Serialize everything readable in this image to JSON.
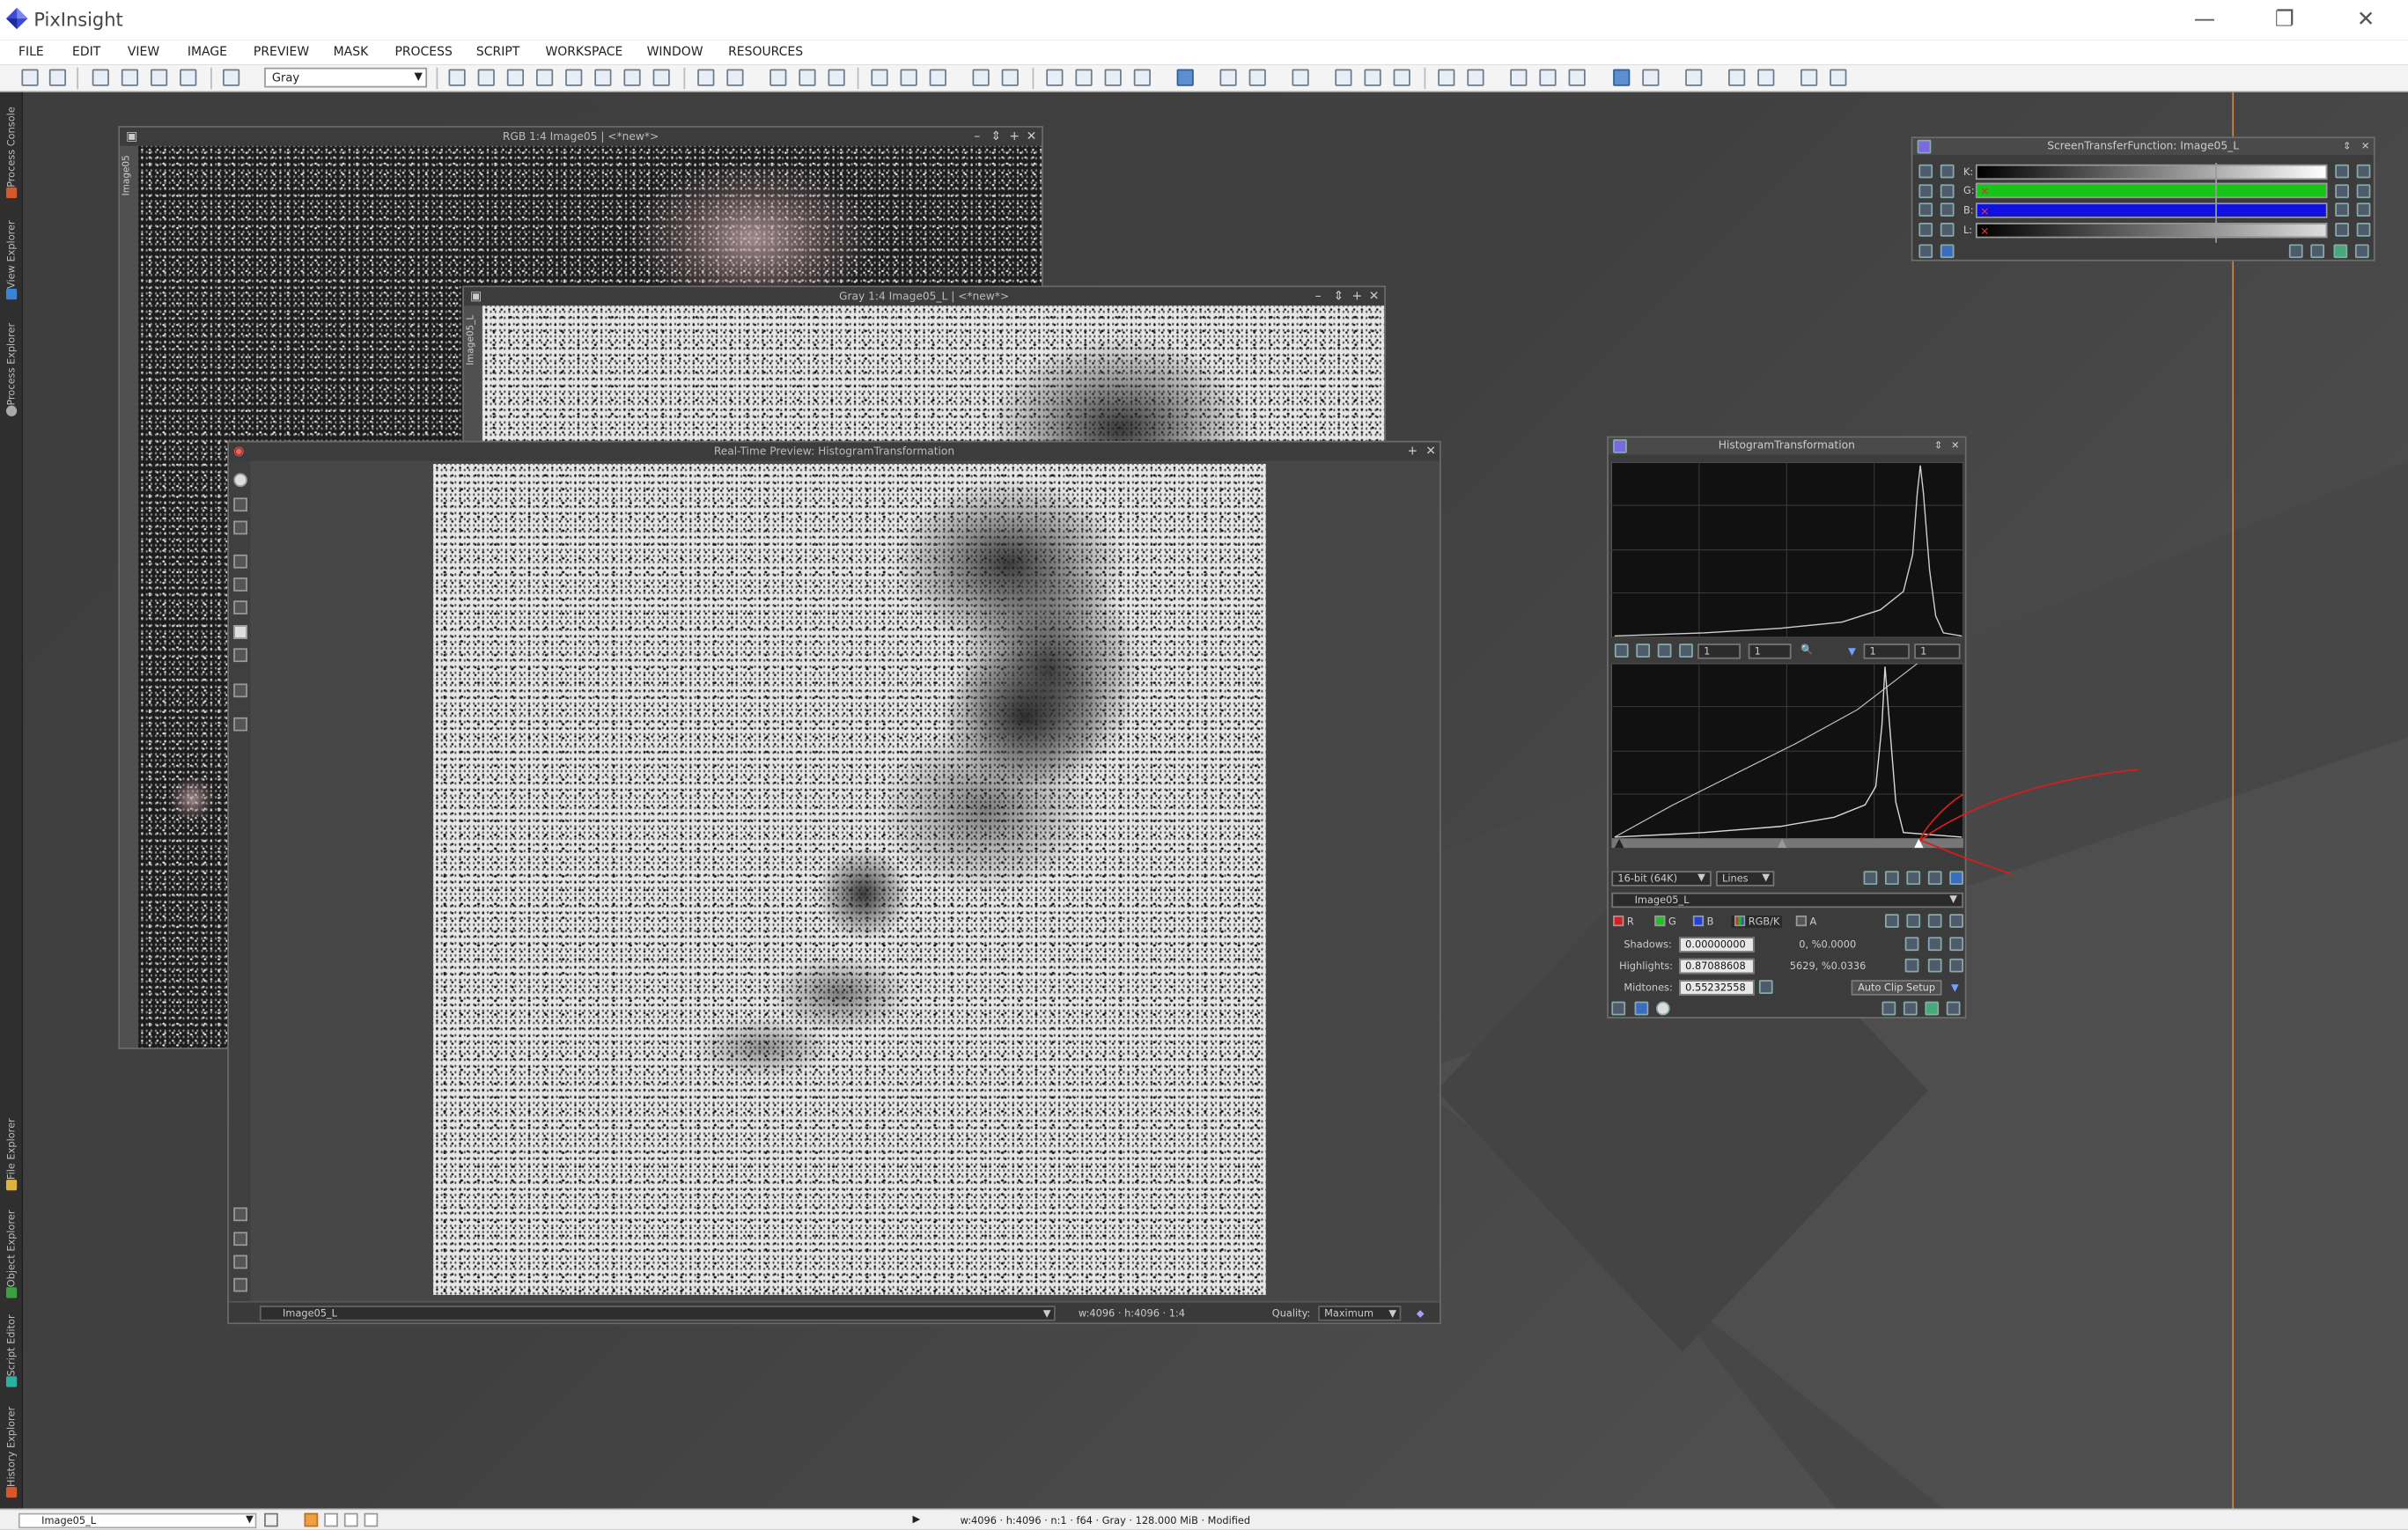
{
  "app": {
    "title": "PixInsight"
  },
  "window_controls": {
    "minimize": "—",
    "restore": "❐",
    "close": "✕"
  },
  "menu": [
    "FILE",
    "EDIT",
    "VIEW",
    "IMAGE",
    "PREVIEW",
    "MASK",
    "PROCESS",
    "SCRIPT",
    "WORKSPACE",
    "WINDOW",
    "RESOURCES"
  ],
  "toolbar": {
    "color_space": "Gray"
  },
  "left_dock": {
    "tabs": [
      "Process Console",
      "View Explorer",
      "Process Explorer",
      "File Explorer",
      "Object Explorer",
      "Script Editor",
      "History Explorer"
    ]
  },
  "windows": {
    "rgb": {
      "title": "RGB 1:4 Image05 | <*new*>",
      "side_label": "Image05"
    },
    "gray": {
      "title": "Gray 1:4 Image05_L | <*new*>",
      "side_label": "Image05_L"
    },
    "preview": {
      "title": "Real-Time Preview: HistogramTransformation",
      "view": "Image05_L",
      "info": "w:4096 · h:4096 · 1:4",
      "quality_label": "Quality:",
      "quality": "Maximum"
    }
  },
  "stf": {
    "title": "ScreenTransferFunction: Image05_L",
    "channels": [
      {
        "label": "K:",
        "color": "#e8e8e8"
      },
      {
        "label": "G:",
        "color": "#19c419"
      },
      {
        "label": "B:",
        "color": "#1010e0"
      },
      {
        "label": "L:",
        "color": "#bdbdbd"
      }
    ]
  },
  "ht": {
    "title": "HistogramTransformation",
    "zoom_fields": [
      "1",
      "1",
      "1",
      "1"
    ],
    "resolution": "16-bit (64K)",
    "graph_style": "Lines",
    "view": "Image05_L",
    "channels": [
      {
        "label": "R",
        "color": "#d62020"
      },
      {
        "label": "G",
        "color": "#22c022"
      },
      {
        "label": "B",
        "color": "#2040e0"
      },
      {
        "label": "RGB/K",
        "color": "#888888"
      },
      {
        "label": "A",
        "color": "#555555"
      }
    ],
    "shadows_label": "Shadows:",
    "shadows": "0.00000000",
    "shadows_clip": "0, %0.0000",
    "highlights_label": "Highlights:",
    "highlights": "0.87088608",
    "highlights_clip": "5629, %0.0336",
    "midtones_label": "Midtones:",
    "midtones": "0.55232558",
    "auto_clip": "Auto Clip Setup"
  },
  "statusbar": {
    "view": "Image05_L",
    "info": "w:4096 · h:4096 · n:1 · f64 · Gray · 128.000 MiB · Modified"
  },
  "colors": {
    "annotation": "#d81c1c",
    "guide_line": "#c8874a",
    "stf_green": "#19c419",
    "stf_blue": "#1010e0"
  }
}
